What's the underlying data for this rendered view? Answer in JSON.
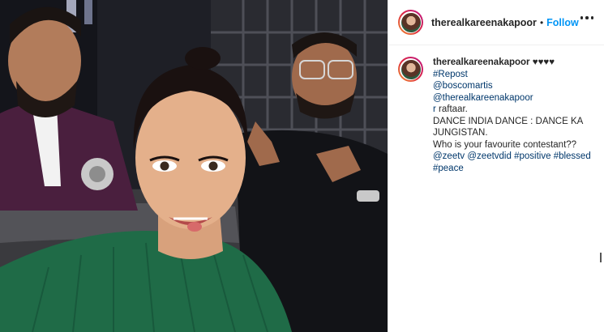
{
  "post": {
    "username": "therealkareenakapoor",
    "dot": "•",
    "follow_label": "Follow"
  },
  "caption": {
    "username": "therealkareenakapoor",
    "hearts": "♥♥♥♥",
    "line_repost": "#Repost",
    "mention_1": "@boscomartis",
    "mention_2": "@therealkareenakapoor",
    "mention_2_tail": "r",
    "text_1": "raftaar.",
    "text_2": "DANCE INDIA DANCE : DANCE KA JUNGISTAN.",
    "text_3": "Who is your favourite contestant??",
    "tags": [
      "@zeetv",
      "@zeetvdid",
      "#positive",
      "#blessed",
      "#peace"
    ]
  },
  "icons": {
    "more": "more-options-icon",
    "avatar": "profile-avatar"
  },
  "colors": {
    "follow": "#0095f6",
    "link": "#00376b",
    "text": "#262626"
  }
}
